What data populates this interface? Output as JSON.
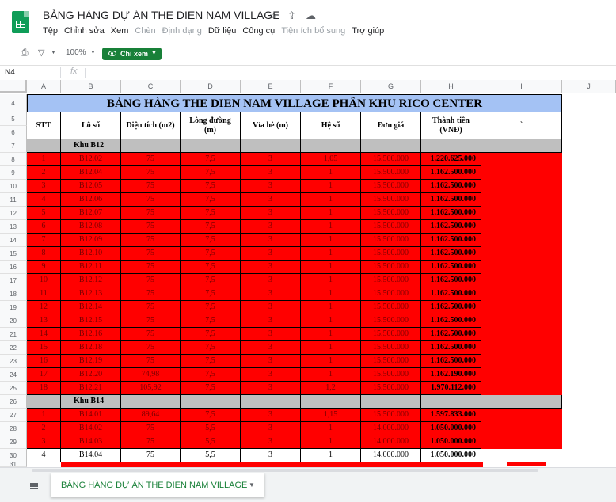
{
  "app": {
    "title": "BẢNG HÀNG DỰ ÁN THE DIEN NAM VILLAGE",
    "menu": [
      "Tệp",
      "Chỉnh sửa",
      "Xem",
      "Chèn",
      "Định dạng",
      "Dữ liệu",
      "Công cụ",
      "Tiện ích bổ sung",
      "Trợ giúp"
    ],
    "menu_disabled": [
      false,
      false,
      false,
      true,
      true,
      false,
      false,
      true,
      false
    ],
    "toolbar": {
      "zoom": "100%",
      "view_label": "Chỉ xem"
    },
    "cell_ref": "N4",
    "fx": "fx",
    "sheet_tab": "BẢNG HÀNG DỰ ÁN THE DIEN NAM VILLAGE",
    "icons": [
      "star-icon",
      "move-to-drive-icon",
      "cloud-status-icon",
      "print-icon",
      "filter-icon",
      "eye-icon",
      "sheet-list-icon"
    ]
  },
  "colors": {
    "brand_green": "#188038",
    "row_red": "#ff0000",
    "title_blue": "#a4c2f4",
    "section_gray": "#bfbfbf"
  },
  "columns": [
    "A",
    "B",
    "C",
    "D",
    "E",
    "F",
    "G",
    "H",
    "I",
    "J"
  ],
  "table": {
    "title": "BẢNG HÀNG THE DIEN NAM VILLAGE PHÂN KHU RICO CENTER",
    "headers": [
      "STT",
      "Lô số",
      "Diện tích (m2)",
      "Lòng đường (m)",
      "Vỉa hè (m)",
      "Hệ số",
      "Đơn giá",
      "Thành tiền (VNĐ)",
      "`"
    ],
    "sections": [
      {
        "name": "Khu B12",
        "row": "7",
        "rows": [
          {
            "r": "8",
            "stt": "1",
            "lot": "B12.02",
            "area": "75",
            "road": "7,5",
            "sw": "3",
            "k": "1,05",
            "price": "15.500.000",
            "total": "1.220.625.000"
          },
          {
            "r": "9",
            "stt": "2",
            "lot": "B12.04",
            "area": "75",
            "road": "7,5",
            "sw": "3",
            "k": "1",
            "price": "15.500.000",
            "total": "1.162.500.000"
          },
          {
            "r": "10",
            "stt": "3",
            "lot": "B12.05",
            "area": "75",
            "road": "7,5",
            "sw": "3",
            "k": "1",
            "price": "15.500.000",
            "total": "1.162.500.000"
          },
          {
            "r": "11",
            "stt": "4",
            "lot": "B12.06",
            "area": "75",
            "road": "7,5",
            "sw": "3",
            "k": "1",
            "price": "15.500.000",
            "total": "1.162.500.000"
          },
          {
            "r": "12",
            "stt": "5",
            "lot": "B12.07",
            "area": "75",
            "road": "7,5",
            "sw": "3",
            "k": "1",
            "price": "15.500.000",
            "total": "1.162.500.000"
          },
          {
            "r": "13",
            "stt": "6",
            "lot": "B12.08",
            "area": "75",
            "road": "7,5",
            "sw": "3",
            "k": "1",
            "price": "15.500.000",
            "total": "1.162.500.000"
          },
          {
            "r": "14",
            "stt": "7",
            "lot": "B12.09",
            "area": "75",
            "road": "7,5",
            "sw": "3",
            "k": "1",
            "price": "15.500.000",
            "total": "1.162.500.000"
          },
          {
            "r": "15",
            "stt": "8",
            "lot": "B12.10",
            "area": "75",
            "road": "7,5",
            "sw": "3",
            "k": "1",
            "price": "15.500.000",
            "total": "1.162.500.000"
          },
          {
            "r": "16",
            "stt": "9",
            "lot": "B12.11",
            "area": "75",
            "road": "7,5",
            "sw": "3",
            "k": "1",
            "price": "15.500.000",
            "total": "1.162.500.000"
          },
          {
            "r": "17",
            "stt": "10",
            "lot": "B12.12",
            "area": "75",
            "road": "7,5",
            "sw": "3",
            "k": "1",
            "price": "15.500.000",
            "total": "1.162.500.000"
          },
          {
            "r": "18",
            "stt": "11",
            "lot": "B12.13",
            "area": "75",
            "road": "7,5",
            "sw": "3",
            "k": "1",
            "price": "15.500.000",
            "total": "1.162.500.000"
          },
          {
            "r": "19",
            "stt": "12",
            "lot": "B12.14",
            "area": "75",
            "road": "7,5",
            "sw": "3",
            "k": "1",
            "price": "15.500.000",
            "total": "1.162.500.000"
          },
          {
            "r": "20",
            "stt": "13",
            "lot": "B12.15",
            "area": "75",
            "road": "7,5",
            "sw": "3",
            "k": "1",
            "price": "15.500.000",
            "total": "1.162.500.000"
          },
          {
            "r": "21",
            "stt": "14",
            "lot": "B12.16",
            "area": "75",
            "road": "7,5",
            "sw": "3",
            "k": "1",
            "price": "15.500.000",
            "total": "1.162.500.000"
          },
          {
            "r": "22",
            "stt": "15",
            "lot": "B12.18",
            "area": "75",
            "road": "7,5",
            "sw": "3",
            "k": "1",
            "price": "15.500.000",
            "total": "1.162.500.000"
          },
          {
            "r": "23",
            "stt": "16",
            "lot": "B12.19",
            "area": "75",
            "road": "7,5",
            "sw": "3",
            "k": "1",
            "price": "15.500.000",
            "total": "1.162.500.000"
          },
          {
            "r": "24",
            "stt": "17",
            "lot": "B12.20",
            "area": "74,98",
            "road": "7,5",
            "sw": "3",
            "k": "1",
            "price": "15.500.000",
            "total": "1.162.190.000"
          },
          {
            "r": "25",
            "stt": "18",
            "lot": "B12.21",
            "area": "105,92",
            "road": "7,5",
            "sw": "3",
            "k": "1,2",
            "price": "15.500.000",
            "total": "1.970.112.000"
          }
        ]
      },
      {
        "name": "Khu B14",
        "row": "26",
        "rows": [
          {
            "r": "27",
            "stt": "1",
            "lot": "B14.01",
            "area": "89,64",
            "road": "7,5",
            "sw": "3",
            "k": "1,15",
            "price": "15.500.000",
            "total": "1.597.833.000"
          },
          {
            "r": "28",
            "stt": "2",
            "lot": "B14.02",
            "area": "75",
            "road": "5,5",
            "sw": "3",
            "k": "1",
            "price": "14.000.000",
            "total": "1.050.000.000"
          },
          {
            "r": "29",
            "stt": "3",
            "lot": "B14.03",
            "area": "75",
            "road": "5,5",
            "sw": "3",
            "k": "1",
            "price": "14.000.000",
            "total": "1.050.000.000"
          },
          {
            "r": "30",
            "stt": "4",
            "lot": "B14.04",
            "area": "75",
            "road": "5,5",
            "sw": "3",
            "k": "1",
            "price": "14.000.000",
            "total": "1.050.000.000",
            "white": true
          }
        ]
      }
    ]
  }
}
